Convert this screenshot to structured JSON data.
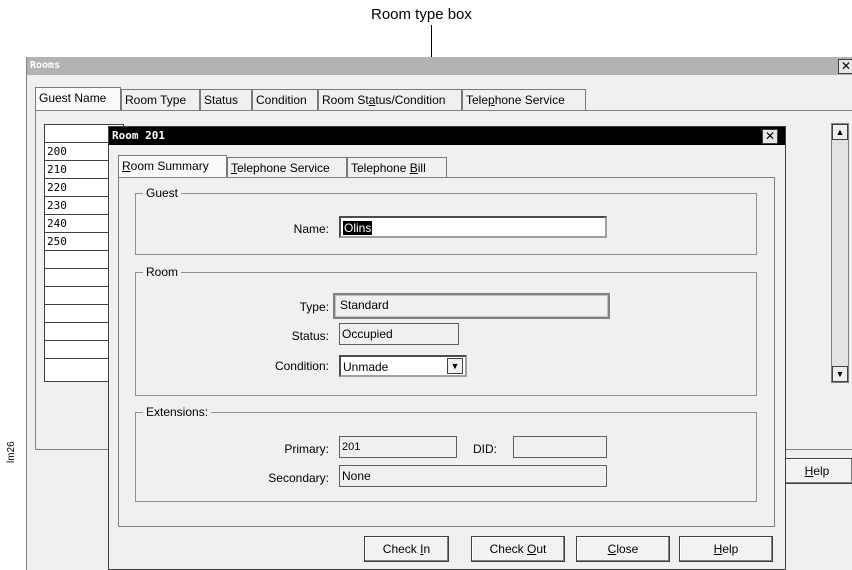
{
  "annotation": {
    "caption": "Room type box"
  },
  "side_code": "lm26",
  "rooms_window": {
    "title": "Rooms",
    "close_glyph": "✕",
    "tabs": [
      {
        "label": "Guest Name",
        "active": true
      },
      {
        "label": "Room Type"
      },
      {
        "label": "Status"
      },
      {
        "label": "Condition"
      },
      {
        "label": "Room Status/Condition"
      },
      {
        "label": "Telephone Service"
      }
    ],
    "room_numbers": [
      "200",
      "210",
      "220",
      "230",
      "240",
      "250",
      "",
      "",
      "",
      "",
      "",
      ""
    ],
    "help_button": "Help"
  },
  "dialog": {
    "title": "Room 201",
    "close_glyph": "✕",
    "tabs": [
      {
        "label": "Room Summary",
        "active": true
      },
      {
        "label": "Telephone Service"
      },
      {
        "label": "Telephone Bill"
      }
    ],
    "guest": {
      "group_label": "Guest",
      "name_label": "Name:",
      "name_value": "Olins"
    },
    "room": {
      "group_label": "Room",
      "type_label": "Type:",
      "type_value": "Standard",
      "status_label": "Status:",
      "status_value": "Occupied",
      "condition_label": "Condition:",
      "condition_value": "Unmade"
    },
    "extensions": {
      "group_label": "Extensions:",
      "primary_label": "Primary:",
      "primary_value": "201",
      "did_label": "DID:",
      "did_value": "",
      "secondary_label": "Secondary:",
      "secondary_value": "None"
    },
    "buttons": {
      "check_in": "Check In",
      "check_out": "Check Out",
      "close": "Close",
      "help": "Help"
    }
  }
}
